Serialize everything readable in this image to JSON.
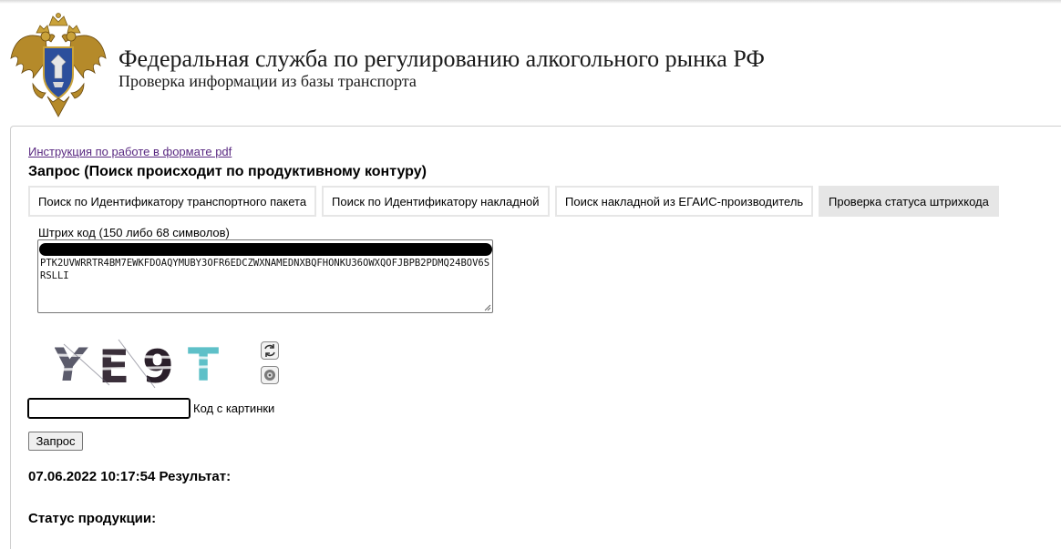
{
  "header": {
    "title": "Федеральная служба по регулированию алкогольного рынка РФ",
    "subtitle": "Проверка информации из базы транспорта",
    "emblem_icon": "double-headed-eagle-emblem"
  },
  "links": {
    "pdf_instructions": "Инструкция по работе в формате pdf"
  },
  "query": {
    "heading": "Запрос (Поиск происходит по продуктивному контуру)"
  },
  "tabs": [
    {
      "label": "Поиск по Идентификатору транспортного пакета",
      "active": false
    },
    {
      "label": "Поиск по Идентификатору накладной",
      "active": false
    },
    {
      "label": "Поиск накладной из ЕГАИС-производитель",
      "active": false
    },
    {
      "label": "Проверка статуса штрихкода",
      "active": true
    }
  ],
  "barcode": {
    "label": "Штрих код (150 либо 68 символов)",
    "value": "PTK2UVWRRTR4BM7EWKFDOAQYMUBY3OFR6EDCZWXNAMEDNXBQFHONKU36OWXQOFJBPB2PDMQ24BOV6SRSLLI"
  },
  "captcha": {
    "text": "YE9T",
    "refresh_icon": "refresh-icon",
    "audio_icon": "speaker-icon",
    "input_value": "",
    "input_label": "Код с картинки"
  },
  "submit": {
    "label": "Запрос"
  },
  "result": {
    "heading": "07.06.2022 10:17:54 Результат:",
    "status_label": "Статус продукции:"
  },
  "colors": {
    "link": "#5a2a82",
    "active_tab": "#e6e6e6",
    "tab_border": "#e6e6e6"
  }
}
